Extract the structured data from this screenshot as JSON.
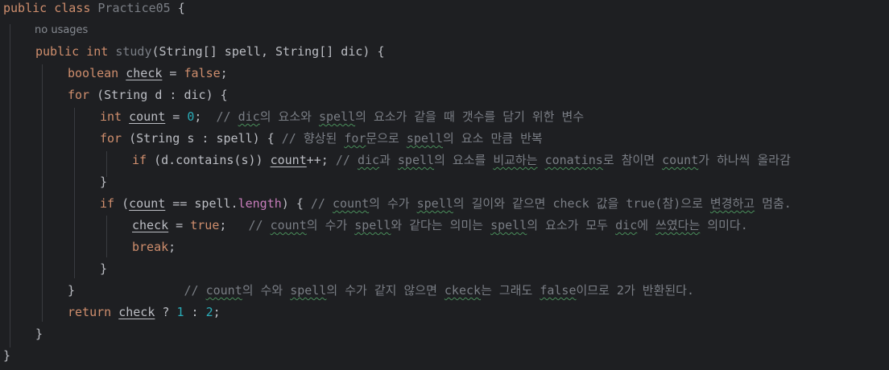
{
  "code": {
    "class_name": "Practice05",
    "usages_hint": "no usages",
    "method_name": "study",
    "var_check": "check",
    "var_count": "count",
    "comment_1_parts": [
      "// ",
      "dic",
      "의 요소와 ",
      "spell",
      "의 요소가 같을 때 갯수를 담기 위한 변수"
    ],
    "comment_2_parts": [
      "// 향상된 ",
      "for",
      "문으로 ",
      "spell",
      "의 요소 만큼 반복"
    ],
    "comment_3_parts": [
      "// ",
      "dic",
      "과 ",
      "spell",
      "의 요소를 ",
      "비교하는",
      " ",
      "conatins",
      "로 참이면 ",
      "count",
      "가 하나씩 올라감"
    ],
    "comment_4_parts": [
      "// ",
      "count",
      "의 수가 ",
      "spell",
      "의 길이와 같으면 check 값을 true(참)으로 ",
      "변경하고",
      " 멈춤."
    ],
    "comment_5_parts": [
      "// ",
      "count",
      "의 수가 ",
      "spell",
      "와 같다는 의미는 ",
      "spell",
      "의 요소가 모두 ",
      "dic",
      "에 ",
      "쓰였다는",
      " 의미다."
    ],
    "comment_6_parts": [
      "// ",
      "count",
      "의 수와 ",
      "spell",
      "의 수가 같지 않으면 ",
      "ckeck",
      "는 그래도 ",
      "false",
      "이므로 2가 반환된다."
    ]
  },
  "colors": {
    "background": "#1e1f22",
    "keyword": "#cf8e6d",
    "text": "#bcbec4",
    "comment": "#7a7e85",
    "number": "#2aacb8",
    "field": "#c77dbb"
  }
}
